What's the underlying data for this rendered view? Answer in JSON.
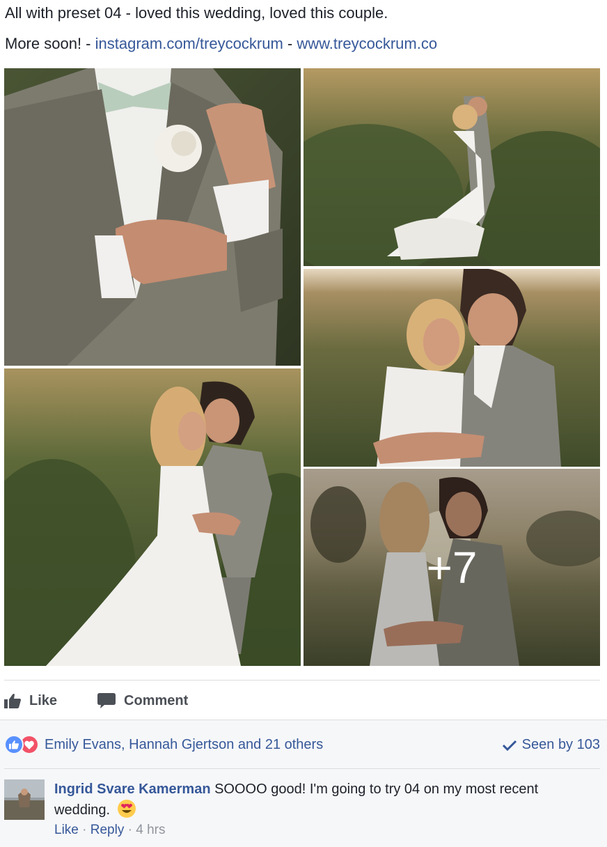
{
  "post": {
    "line1": "All with preset 04 - loved this wedding, loved this couple.",
    "line2_prefix": "More soon! - ",
    "link1": "instagram.com/treycockrum",
    "separator": " - ",
    "link2": "www.treycockrum.co"
  },
  "photos": {
    "more_count": "+7"
  },
  "actions": {
    "like_label": "Like",
    "comment_label": "Comment"
  },
  "reactions": {
    "names": "Emily Evans, Hannah Gjertson and 21 others",
    "seen_by": "Seen by 103"
  },
  "comment": {
    "author": "Ingrid Svare Kamerman",
    "text": " SOOOO good! I'm going to try 04 on my most recent wedding.",
    "like_label": "Like",
    "dot1": " · ",
    "reply_label": "Reply",
    "dot2": " · ",
    "time": "4 hrs"
  },
  "colors": {
    "link": "#365899",
    "action_text": "#4b4f56",
    "like_reaction": "#5890ff",
    "love_reaction": "#f25268",
    "panel_bg": "#f6f7f9"
  },
  "icons": [
    "thumbs-up-icon",
    "speech-bubble-icon",
    "like-reaction-icon",
    "love-reaction-icon",
    "checkmark-icon",
    "heart-eyes-emoji-icon"
  ]
}
